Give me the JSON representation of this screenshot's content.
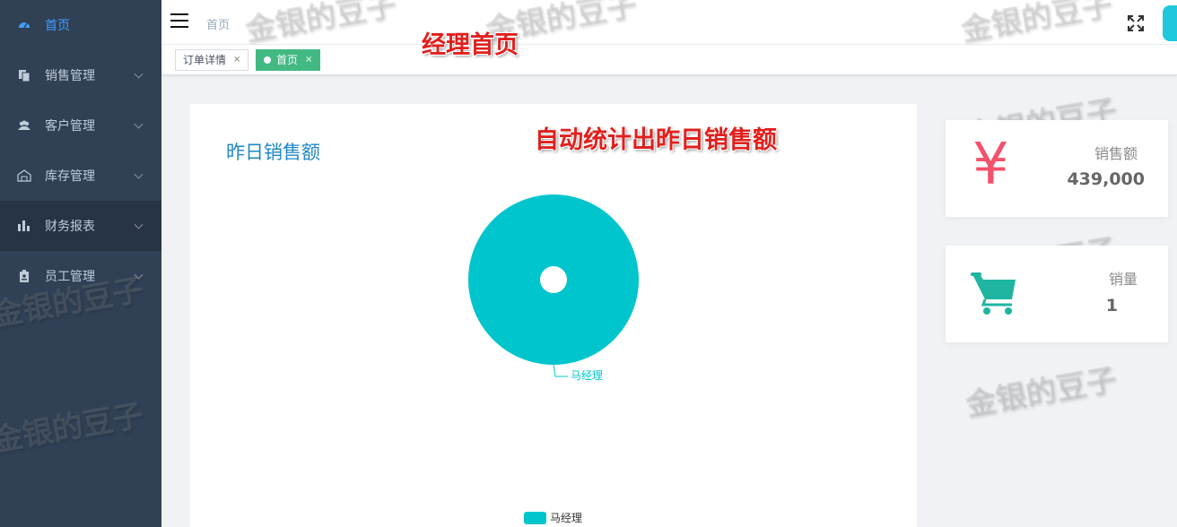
{
  "sidebar": {
    "items": [
      {
        "label": "首页",
        "icon": "dashboard-icon"
      },
      {
        "label": "销售管理",
        "icon": "copy-icon"
      },
      {
        "label": "客户管理",
        "icon": "users-icon"
      },
      {
        "label": "库存管理",
        "icon": "warehouse-icon"
      },
      {
        "label": "财务报表",
        "icon": "bar-chart-icon"
      },
      {
        "label": "员工管理",
        "icon": "badge-icon"
      }
    ]
  },
  "navbar": {
    "breadcrumb": "首页"
  },
  "tags": [
    {
      "label": "订单详情",
      "close": "×"
    },
    {
      "label": "首页",
      "close": "×"
    }
  ],
  "annotations": {
    "page_note": "经理首页",
    "chart_note": "自动统计出昨日销售额"
  },
  "chart_card": {
    "title": "昨日销售额"
  },
  "chart_data": {
    "type": "pie",
    "title": "昨日销售额",
    "slices": [
      {
        "name": "马经理",
        "value": 439000
      }
    ],
    "colors": [
      "#00c5cd"
    ],
    "legend_position": "bottom-center"
  },
  "stats": {
    "sales": {
      "label": "销售额",
      "value": "439,000",
      "icon": "yen-icon",
      "symbol": "¥",
      "color": "#f4516c"
    },
    "volume": {
      "label": "销量",
      "value": "1",
      "icon": "cart-icon",
      "color": "#1fb5a0"
    }
  },
  "watermark": {
    "text": "金银的豆子"
  },
  "colors": {
    "sidebar_bg": "#304156",
    "active_tag": "#42b983",
    "chart_title": "#1e88c7",
    "pie": "#00c5cd",
    "annotation": "#e0201d"
  }
}
